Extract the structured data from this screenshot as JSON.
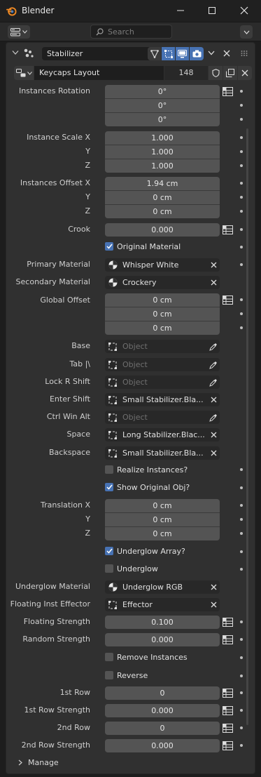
{
  "window": {
    "title": "Blender"
  },
  "header": {
    "search_placeholder": "Search"
  },
  "modifier": {
    "name": "Stabilizer"
  },
  "node_group": {
    "name": "Keycaps Layout",
    "users": "148"
  },
  "rows": {
    "instances_rotation": {
      "label": "Instances Rotation",
      "values": [
        "0°",
        "0°",
        "0°"
      ]
    },
    "instance_scale": {
      "labels": [
        "Instance Scale X",
        "Y",
        "Z"
      ],
      "values": [
        "1.000",
        "1.000",
        "1.000"
      ]
    },
    "instances_offset": {
      "labels": [
        "Instances Offset X",
        "Y",
        "Z"
      ],
      "values": [
        "1.94 cm",
        "0 cm",
        "0 cm"
      ]
    },
    "crook": {
      "label": "Crook",
      "value": "0.000"
    },
    "original_material": {
      "label": "Original Material",
      "checked": true
    },
    "primary_material": {
      "label": "Primary Material",
      "value": "Whisper White"
    },
    "secondary_material": {
      "label": "Secondary Material",
      "value": "Crockery"
    },
    "global_offset": {
      "label": "Global Offset",
      "values": [
        "0 cm",
        "0 cm",
        "0 cm"
      ]
    },
    "base": {
      "label": "Base",
      "placeholder": "Object"
    },
    "tab": {
      "label": "Tab |\\",
      "placeholder": "Object"
    },
    "lock_r_shift": {
      "label": "Lock R Shift",
      "placeholder": "Object"
    },
    "enter_shift": {
      "label": "Enter Shift",
      "value": "Small Stabilizer.Bla..."
    },
    "ctrl_win_alt": {
      "label": "Ctrl Win Alt",
      "placeholder": "Object"
    },
    "space": {
      "label": "Space",
      "value": "Long Stabilizer.Blac..."
    },
    "backspace": {
      "label": "Backspace",
      "value": "Small Stabilizer.Bla..."
    },
    "realize_instances": {
      "label": "Realize Instances?",
      "checked": false
    },
    "show_original_obj": {
      "label": "Show Original Obj?",
      "checked": true
    },
    "translation": {
      "labels": [
        "Translation X",
        "Y",
        "Z"
      ],
      "values": [
        "0 cm",
        "0 cm",
        "0 cm"
      ]
    },
    "underglow_array": {
      "label": "Underglow Array?",
      "checked": true
    },
    "underglow": {
      "label": "Underglow",
      "checked": false
    },
    "underglow_material": {
      "label": "Underglow Material",
      "value": "Underglow RGB"
    },
    "floating_inst_effector": {
      "label": "Floating Inst Effector",
      "value": "Effector"
    },
    "floating_strength": {
      "label": "Floating Strength",
      "value": "0.100"
    },
    "random_strength": {
      "label": "Random Strength",
      "value": "0.000"
    },
    "remove_instances": {
      "label": "Remove Instances",
      "checked": false
    },
    "reverse": {
      "label": "Reverse",
      "checked": false
    },
    "row1": {
      "label": "1st Row",
      "value": "0"
    },
    "row1_strength": {
      "label": "1st Row Strength",
      "value": "0.000"
    },
    "row2": {
      "label": "2nd Row",
      "value": "0"
    },
    "row2_strength": {
      "label": "2nd Row Strength",
      "value": "0.000"
    }
  },
  "manage": {
    "label": "Manage"
  },
  "colors": {
    "accent": "#4772b3",
    "field": "#545454",
    "panel": "#303030",
    "background": "#1d1d1d"
  }
}
